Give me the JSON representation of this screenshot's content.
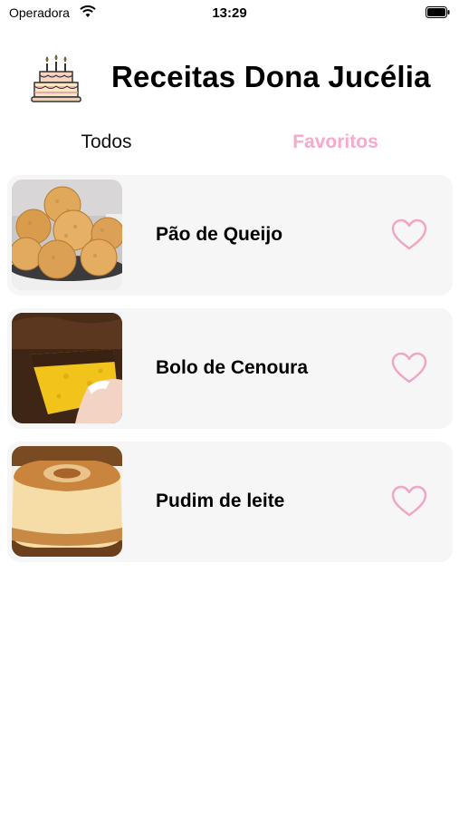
{
  "status_bar": {
    "carrier": "Operadora",
    "time": "13:29"
  },
  "header": {
    "title": "Receitas Dona Jucélia",
    "icon": "birthday-cake-icon"
  },
  "tabs": [
    {
      "label": "Todos",
      "selected": false
    },
    {
      "label": "Favoritos",
      "selected": true
    }
  ],
  "recipes": [
    {
      "name": "Pão de Queijo",
      "image": "pao-de-queijo-photo",
      "favorite": false
    },
    {
      "name": "Bolo de Cenoura",
      "image": "bolo-de-cenoura-photo",
      "favorite": false
    },
    {
      "name": "Pudim de leite",
      "image": "pudim-de-leite-photo",
      "favorite": false
    }
  ],
  "colors": {
    "accent_pink": "#f7a9cc",
    "card_background": "#f6f6f7",
    "heart_stroke": "#f0a6c6"
  }
}
